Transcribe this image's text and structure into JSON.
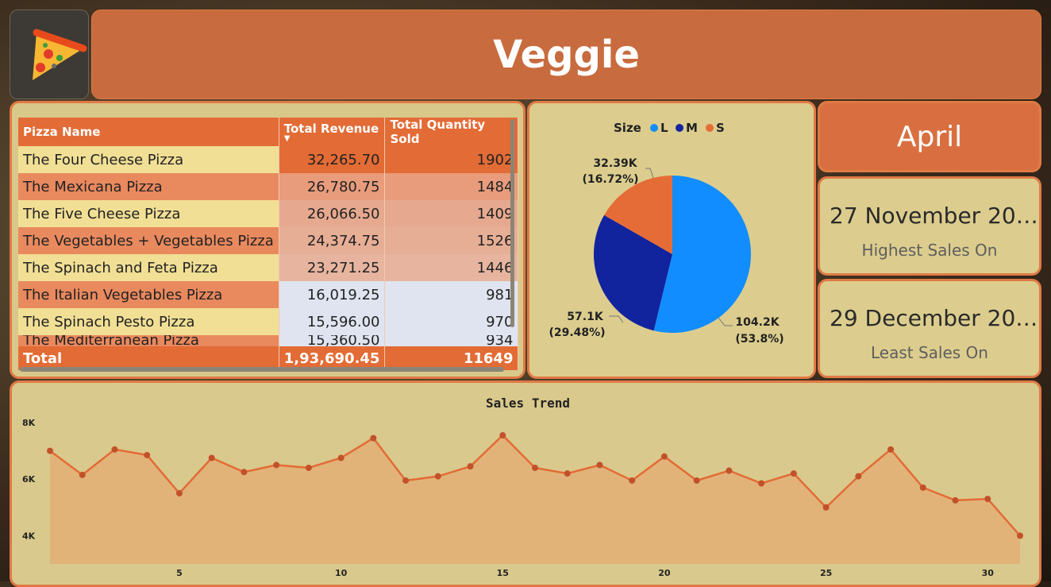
{
  "header": {
    "title": "Veggie",
    "logo_icon": "pizza-slice-icon"
  },
  "table": {
    "columns": [
      "Pizza Name",
      "Total Revenue",
      "Total Quantity Sold"
    ],
    "sort_indicator": "▼",
    "rows": [
      {
        "name": "The Four Cheese Pizza",
        "revenue": "32,265.70",
        "qty": "1902",
        "rev_color": "#e36b35"
      },
      {
        "name": "The Mexicana Pizza",
        "revenue": "26,780.75",
        "qty": "1484",
        "rev_color": "#e89c7c"
      },
      {
        "name": "The Five Cheese Pizza",
        "revenue": "26,066.50",
        "qty": "1409",
        "rev_color": "#e6a98f"
      },
      {
        "name": "The Vegetables + Vegetables Pizza",
        "revenue": "24,374.75",
        "qty": "1526",
        "rev_color": "#e7ae96"
      },
      {
        "name": "The Spinach and Feta Pizza",
        "revenue": "23,271.25",
        "qty": "1446",
        "rev_color": "#e7b59f"
      },
      {
        "name": "The Italian Vegetables Pizza",
        "revenue": "16,019.25",
        "qty": "981",
        "rev_color": "#dfe4f0"
      },
      {
        "name": "The Spinach Pesto Pizza",
        "revenue": "15,596.00",
        "qty": "970",
        "rev_color": "#dfe4f0"
      },
      {
        "name": "The Mediterranean Pizza",
        "revenue": "15,360.50",
        "qty": "934",
        "rev_color": "#dfe4f0"
      }
    ],
    "total": {
      "label": "Total",
      "revenue": "1,93,690.45",
      "qty": "11649"
    }
  },
  "pie": {
    "legend_title": "Size",
    "legend": [
      {
        "label": "L",
        "color": "#118dff"
      },
      {
        "label": "M",
        "color": "#12239e"
      },
      {
        "label": "S",
        "color": "#e66c37"
      }
    ],
    "label_l": {
      "value": "104.2K",
      "pct": "(53.8%)"
    },
    "label_m": {
      "value": "57.1K",
      "pct": "(29.48%)"
    },
    "label_s": {
      "value": "32.39K",
      "pct": "(16.72%)"
    }
  },
  "cards": {
    "month": "April",
    "highest": {
      "value": "27 November 20…",
      "label": "Highest Sales On"
    },
    "lowest": {
      "value": "29 December 20…",
      "label": "Least Sales On"
    }
  },
  "chart_data": [
    {
      "type": "pie",
      "legend_title": "Size",
      "labels": [
        "L",
        "M",
        "S"
      ],
      "values": [
        104.2,
        57.1,
        32.39
      ],
      "unit": "K",
      "percentages": [
        53.8,
        29.48,
        16.72
      ],
      "colors": [
        "#118dff",
        "#12239e",
        "#e66c37"
      ],
      "legend_placement": "top"
    },
    {
      "type": "area",
      "title": "Sales Trend",
      "x": [
        1,
        2,
        3,
        4,
        5,
        6,
        7,
        8,
        9,
        10,
        11,
        12,
        13,
        14,
        15,
        16,
        17,
        18,
        19,
        20,
        21,
        22,
        23,
        24,
        25,
        26,
        27,
        28,
        29,
        30,
        31
      ],
      "x_ticks": [
        5,
        10,
        15,
        20,
        25,
        30
      ],
      "y_ticks": [
        {
          "value": 4000,
          "label": "4K"
        },
        {
          "value": 6000,
          "label": "6K"
        },
        {
          "value": 8000,
          "label": "8K"
        }
      ],
      "values": [
        7000,
        6150,
        7050,
        6850,
        5500,
        6750,
        6250,
        6500,
        6400,
        6750,
        7450,
        5950,
        6100,
        6450,
        7550,
        6400,
        6200,
        6500,
        5950,
        6800,
        5950,
        6300,
        5850,
        6200,
        5000,
        6100,
        7050,
        5700,
        5250,
        5300,
        4000
      ],
      "ylim": [
        3000,
        8000
      ],
      "color": "#e36b35"
    }
  ]
}
